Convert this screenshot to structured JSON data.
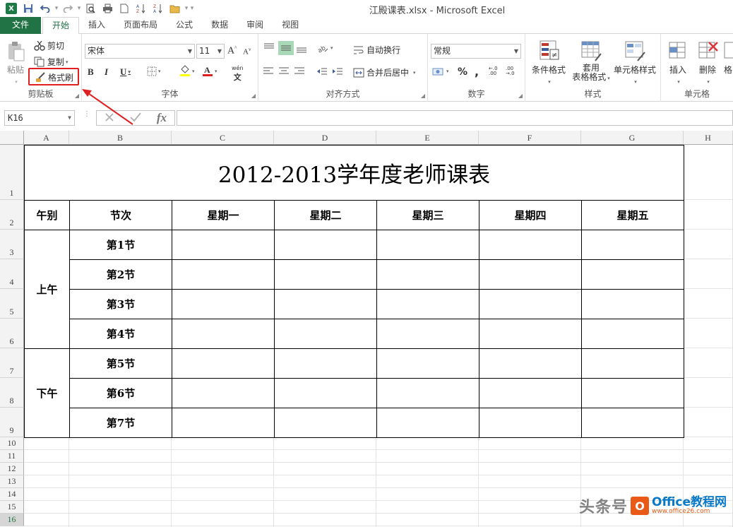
{
  "window": {
    "title": "江殿课表.xlsx - Microsoft Excel"
  },
  "tabs": [
    "文件",
    "开始",
    "插入",
    "页面布局",
    "公式",
    "数据",
    "审阅",
    "视图"
  ],
  "clipboard": {
    "paste": "粘贴",
    "cut": "剪切",
    "copy": "复制",
    "format_painter": "格式刷",
    "label": "剪贴板"
  },
  "font": {
    "name": "宋体",
    "size": "11",
    "bold": "B",
    "italic": "I",
    "underline": "U",
    "phonetic": "wén",
    "label": "字体"
  },
  "alignment": {
    "wrap": "自动换行",
    "merge": "合并后居中",
    "label": "对齐方式"
  },
  "number": {
    "format": "常规",
    "percent": "%",
    "comma": ",",
    "inc": "←.0 .00",
    "dec": ".00 →.0",
    "label": "数字"
  },
  "styles": {
    "conditional": "条件格式",
    "table_format_1": "套用",
    "table_format_2": "表格格式",
    "cell_styles": "单元格样式",
    "label": "样式"
  },
  "cells": {
    "insert": "插入",
    "delete": "删除",
    "format": "格",
    "label": "单元格"
  },
  "formula_bar": {
    "name_box": "K16",
    "fx": "fx",
    "content": ""
  },
  "columns": [
    "A",
    "B",
    "C",
    "D",
    "E",
    "F",
    "G",
    "H"
  ],
  "rows": [
    "1",
    "2",
    "3",
    "4",
    "5",
    "6",
    "7",
    "8",
    "9",
    "10",
    "11",
    "12",
    "13",
    "14",
    "15",
    "16"
  ],
  "timetable": {
    "title": "2012-2013学年度老师课表",
    "headers": [
      "午别",
      "节次",
      "星期一",
      "星期二",
      "星期三",
      "星期四",
      "星期五"
    ],
    "morning": "上午",
    "afternoon": "下午",
    "periods": [
      "第1节",
      "第2节",
      "第3节",
      "第4节",
      "第5节",
      "第6节",
      "第7节"
    ]
  },
  "watermark": {
    "text": "头条号",
    "brand": "Office教程网",
    "url": "www.office26.com"
  },
  "colors": {
    "accent": "#217346",
    "highlight": "#e02020"
  }
}
